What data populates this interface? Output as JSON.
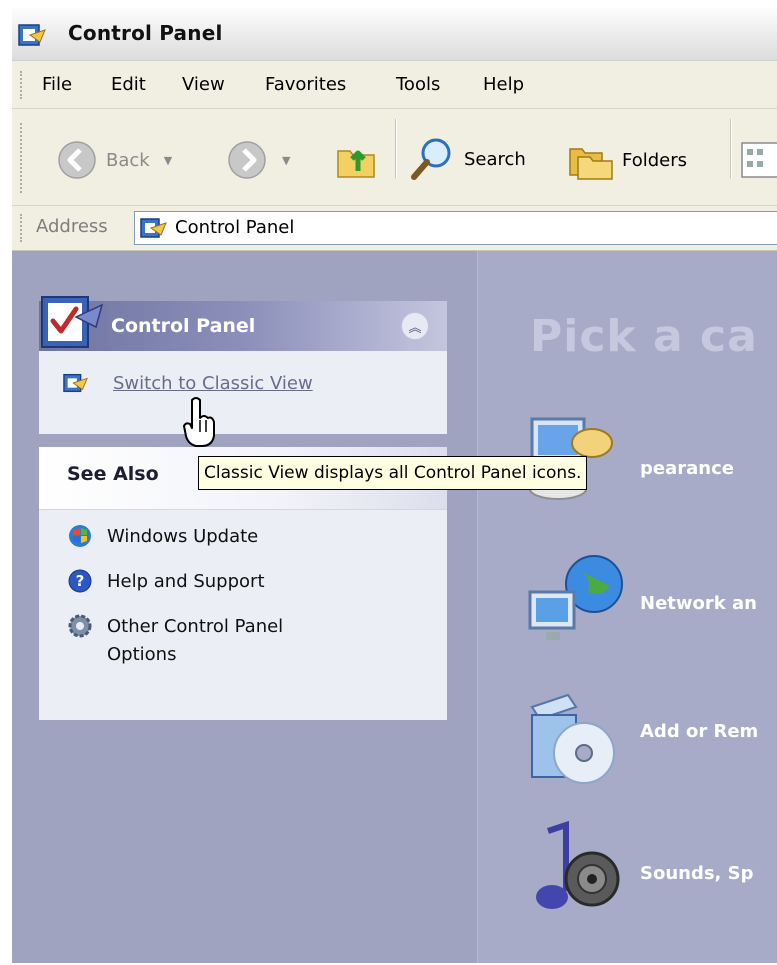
{
  "window": {
    "title": "Control Panel"
  },
  "menu": [
    "File",
    "Edit",
    "View",
    "Favorites",
    "Tools",
    "Help"
  ],
  "toolbar": {
    "back_label": "Back",
    "search_label": "Search",
    "folders_label": "Folders"
  },
  "address": {
    "label": "Address",
    "value": "Control Panel"
  },
  "taskpane": {
    "control_panel_box": {
      "title": "Control Panel",
      "switch_link": "Switch to Classic View"
    },
    "see_also": {
      "title": "See Also",
      "items": [
        {
          "label": "Windows Update",
          "icon": "windows-update-icon"
        },
        {
          "label": "Help and Support",
          "icon": "help-icon"
        },
        {
          "label": "Other Control Panel\nOptions",
          "icon": "options-gear-icon"
        }
      ]
    }
  },
  "tooltip": "Classic View displays all Control Panel icons.",
  "main": {
    "heading": "Pick a ca",
    "categories": [
      {
        "label": "pearance",
        "icon": "appearance-icon"
      },
      {
        "label": "Network an",
        "icon": "network-icon"
      },
      {
        "label": "Add or Rem",
        "icon": "add-remove-programs-icon"
      },
      {
        "label": "Sounds, Sp",
        "icon": "sounds-icon"
      }
    ]
  },
  "colors": {
    "taskpane": "#9fa3c0",
    "main_bg": "#a7abc8",
    "tooltip_bg": "#ffffe1"
  }
}
